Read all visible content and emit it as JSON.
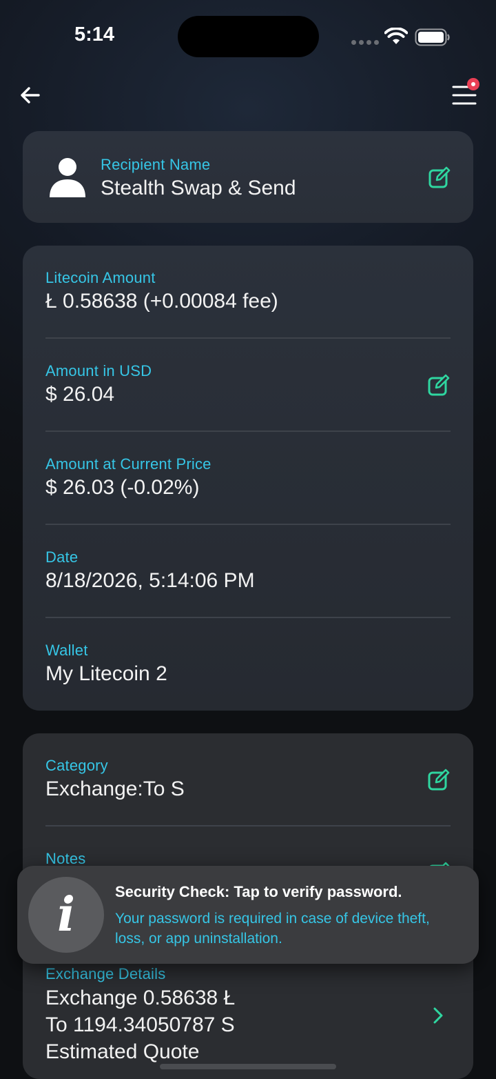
{
  "status_bar": {
    "time": "5:14"
  },
  "recipient": {
    "label": "Recipient Name",
    "value": "Stealth Swap & Send"
  },
  "details": {
    "rows": [
      {
        "label": "Litecoin Amount",
        "value": "Ł 0.58638 (+0.00084 fee)"
      },
      {
        "label": "Amount in USD",
        "value": "$ 26.04"
      },
      {
        "label": "Amount at Current Price",
        "value": "$ 26.03 (-0.02%)"
      },
      {
        "label": "Date",
        "value": "8/18/2026, 5:14:06 PM"
      },
      {
        "label": "Wallet",
        "value": "My Litecoin 2"
      }
    ]
  },
  "category_card": {
    "category_label": "Category",
    "category_value": "Exchange:To S",
    "notes_label": "Notes",
    "exchange_label": "Exchange Details",
    "exchange_lines": [
      "Exchange 0.58638 Ł",
      "To 1194.34050787 S",
      "Estimated Quote"
    ]
  },
  "toast": {
    "icon_glyph": "i",
    "title": "Security Check: Tap to verify password.",
    "body": "Your password is required in case of device theft, loss, or app uninstallation."
  },
  "colors": {
    "accent_cyan": "#36c6e6",
    "accent_green": "#2fd6a0",
    "badge_red": "#ea3f55"
  }
}
